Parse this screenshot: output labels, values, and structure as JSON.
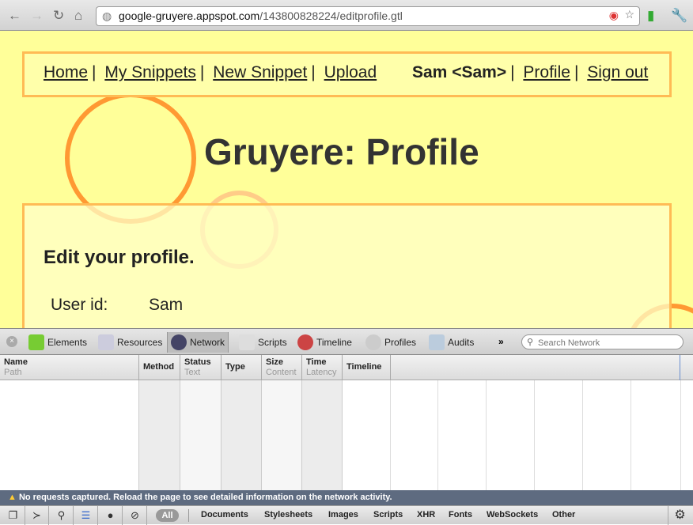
{
  "browser": {
    "url_host": "google-gruyere.appspot.com",
    "url_path": "/143800828224/editprofile.gtl"
  },
  "page": {
    "nav": [
      "Home",
      "My Snippets",
      "New Snippet",
      "Upload"
    ],
    "user": "Sam <Sam>",
    "user_links": [
      "Profile",
      "Sign out"
    ],
    "separator": "|",
    "title": "Gruyere: Profile",
    "heading": "Edit your profile.",
    "user_id_label": "User id:",
    "user_id_value": "Sam"
  },
  "devtools": {
    "tabs": [
      "Elements",
      "Resources",
      "Network",
      "Scripts",
      "Timeline",
      "Profiles",
      "Audits"
    ],
    "more": "»",
    "search_placeholder": "Search Network",
    "columns": [
      {
        "title": "Name",
        "sub": "Path"
      },
      {
        "title": "Method",
        "sub": ""
      },
      {
        "title": "Status",
        "sub": "Text"
      },
      {
        "title": "Type",
        "sub": ""
      },
      {
        "title": "Size",
        "sub": "Content"
      },
      {
        "title": "Time",
        "sub": "Latency"
      },
      {
        "title": "Timeline",
        "sub": ""
      }
    ],
    "status_message": "No requests captured. Reload the page to see detailed information on the network activity.",
    "filters": [
      "All",
      "Documents",
      "Stylesheets",
      "Images",
      "Scripts",
      "XHR",
      "Fonts",
      "WebSockets",
      "Other"
    ]
  }
}
